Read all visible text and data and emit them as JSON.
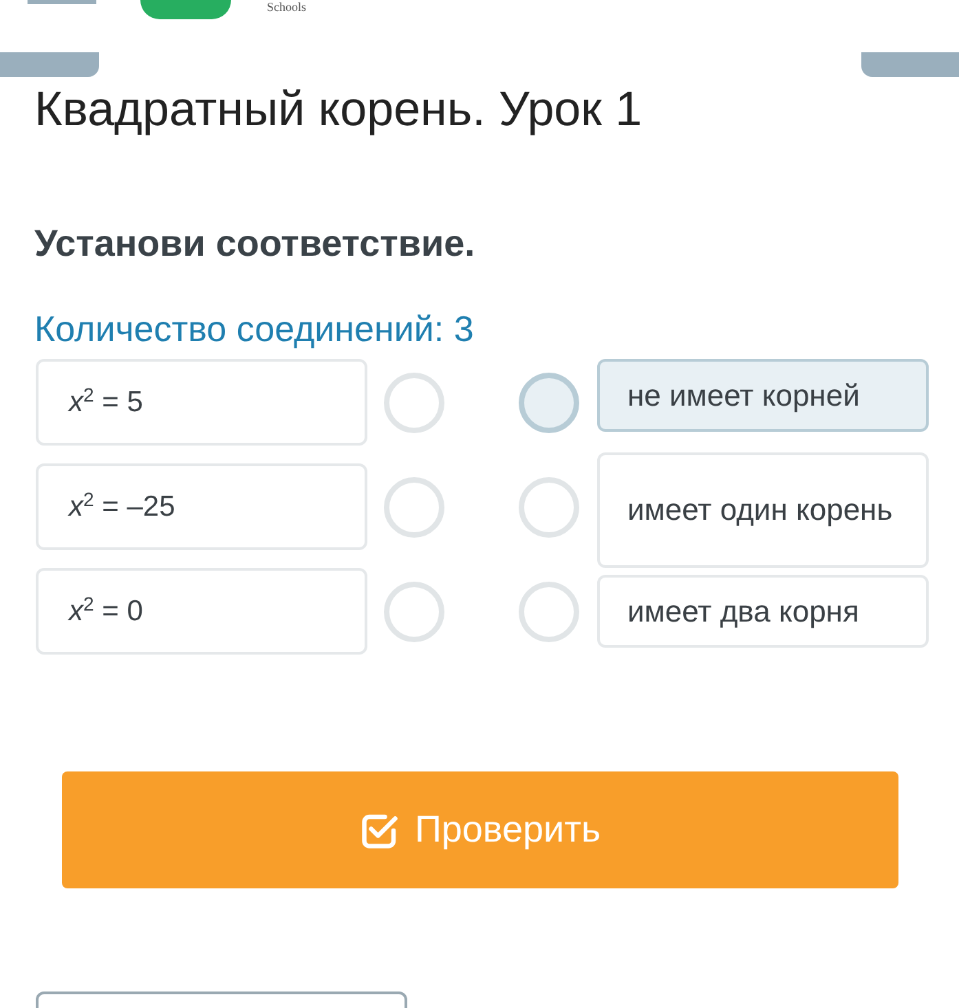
{
  "header": {
    "logo_caption": "Schools"
  },
  "title": "Квадратный корень. Урок 1",
  "task": "Установи соответствие.",
  "connections": "Количество соединений: 3",
  "left_items": [
    {
      "text": "*x*$^{2}$ = 5",
      "selected": false
    },
    {
      "text": "*x*$^{2}$ = –25",
      "selected": false
    },
    {
      "text": "*x*$^{2}$ = 0",
      "selected": false
    }
  ],
  "right_items": [
    {
      "text": "не имеет корней",
      "selected": true
    },
    {
      "text": "имеет один корень",
      "selected": false
    },
    {
      "text": "имеет два корня",
      "selected": false
    }
  ],
  "check_button": {
    "label": "Проверить"
  }
}
